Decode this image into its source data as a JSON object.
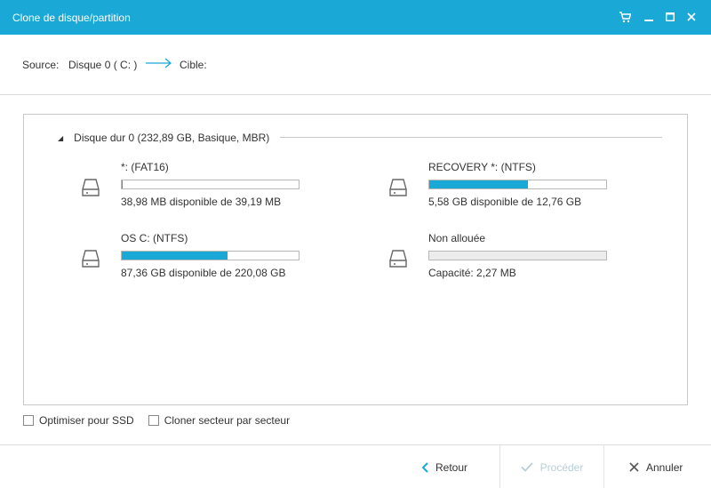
{
  "window": {
    "title": "Clone de disque/partition",
    "buttons": [
      "cart-icon",
      "minimize-icon",
      "maximize-icon",
      "close-icon"
    ],
    "accent": "#1aa8d6"
  },
  "source_bar": {
    "source_label": "Source:",
    "source_value": "Disque 0 ( C: )",
    "target_label": "Cible:"
  },
  "disk": {
    "title": "Disque dur 0 (232,89 GB, Basique, MBR)",
    "partitions": [
      {
        "name": "*: (FAT16)",
        "info": "38,98 MB disponible de 39,19 MB",
        "used_fraction": 0.005
      },
      {
        "name": "RECOVERY *: (NTFS)",
        "info": "5,58 GB disponible de 12,76 GB",
        "used_fraction": 0.56
      },
      {
        "name": "OS C: (NTFS)",
        "info": "87,36 GB disponible de 220,08 GB",
        "used_fraction": 0.6
      },
      {
        "name": "Non allouée",
        "info": "Capacité: 2,27 MB",
        "used_fraction": 0
      }
    ]
  },
  "options": {
    "ssd": "Optimiser pour SSD",
    "sector": "Cloner secteur par secteur"
  },
  "footer": {
    "back": "Retour",
    "proceed": "Procéder",
    "cancel": "Annuler"
  }
}
